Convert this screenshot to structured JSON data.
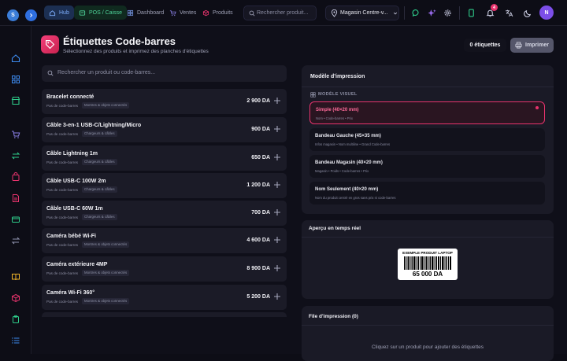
{
  "topbar": {
    "avatar_letter": "S",
    "nav": [
      {
        "label": "Hub",
        "icon": "home-icon"
      },
      {
        "label": "POS / Caisse",
        "icon": "pos-icon"
      },
      {
        "label": "Dashboard",
        "icon": "dashboard-icon"
      },
      {
        "label": "Ventes",
        "icon": "cart-icon"
      },
      {
        "label": "Produits",
        "icon": "box-icon"
      }
    ],
    "search_placeholder": "Rechercher produit...",
    "store_label": "Magasin Centre-v...",
    "notification_count": "4",
    "user_initial": "N"
  },
  "page": {
    "title": "Étiquettes Code-barres",
    "subtitle": "Sélectionnez des produits et imprimez des planches d'étiquettes",
    "label_count": "0 étiquettes",
    "print_button": "Imprimer"
  },
  "product_search": {
    "placeholder": "Rechercher un produit ou code-barres..."
  },
  "products": [
    {
      "name": "Bracelet connecté",
      "barcode": "Pas de code-barres",
      "category": "Montres & objets connectés",
      "price": "2 900 DA"
    },
    {
      "name": "Câble 3-en-1 USB-C/Lightning/Micro",
      "barcode": "Pas de code-barres",
      "category": "Chargeurs & câbles",
      "price": "900 DA"
    },
    {
      "name": "Câble Lightning 1m",
      "barcode": "Pas de code-barres",
      "category": "Chargeurs & câbles",
      "price": "650 DA"
    },
    {
      "name": "Câble USB-C 100W 2m",
      "barcode": "Pas de code-barres",
      "category": "Chargeurs & câbles",
      "price": "1 200 DA"
    },
    {
      "name": "Câble USB-C 60W 1m",
      "barcode": "Pas de code-barres",
      "category": "Chargeurs & câbles",
      "price": "700 DA"
    },
    {
      "name": "Caméra bébé Wi-Fi",
      "barcode": "Pas de code-barres",
      "category": "Montres & objets connectés",
      "price": "4 600 DA"
    },
    {
      "name": "Caméra extérieure 4MP",
      "barcode": "Pas de code-barres",
      "category": "Montres & objets connectés",
      "price": "8 900 DA"
    },
    {
      "name": "Caméra Wi-Fi 360°",
      "barcode": "Pas de code-barres",
      "category": "Montres & objets connectés",
      "price": "5 200 DA"
    }
  ],
  "print_model": {
    "title": "Modèle d'impression",
    "section_label": "MODÈLE VISUEL",
    "options": [
      {
        "title": "Simple (40×20 mm)",
        "desc": "Nom • Code-barres • Prix",
        "selected": true
      },
      {
        "title": "Bandeau Gauche (45×35 mm)",
        "desc": "Infos magasin • Nom multiline • Grand Code-barres",
        "selected": false
      },
      {
        "title": "Bandeau Magasin (40×20 mm)",
        "desc": "Magasin • Poids • Code-barres • Prix",
        "selected": false
      },
      {
        "title": "Nom Seulement (40×20 mm)",
        "desc": "Nom du produit centré en gros sans prix ni code-barres",
        "selected": false
      }
    ]
  },
  "preview": {
    "title": "Aperçu en temps réel",
    "label_name": "EXEMPLE PRODUIT LAPTOP",
    "label_price": "65 000 DA"
  },
  "queue": {
    "title": "File d'impression (0)",
    "empty_text": "Cliquez sur un produit pour ajouter des étiquettes"
  },
  "colors": {
    "accent": "#e8336d",
    "background": "#0f0f19",
    "panel": "#1a1a26",
    "card": "#1b1b27"
  }
}
